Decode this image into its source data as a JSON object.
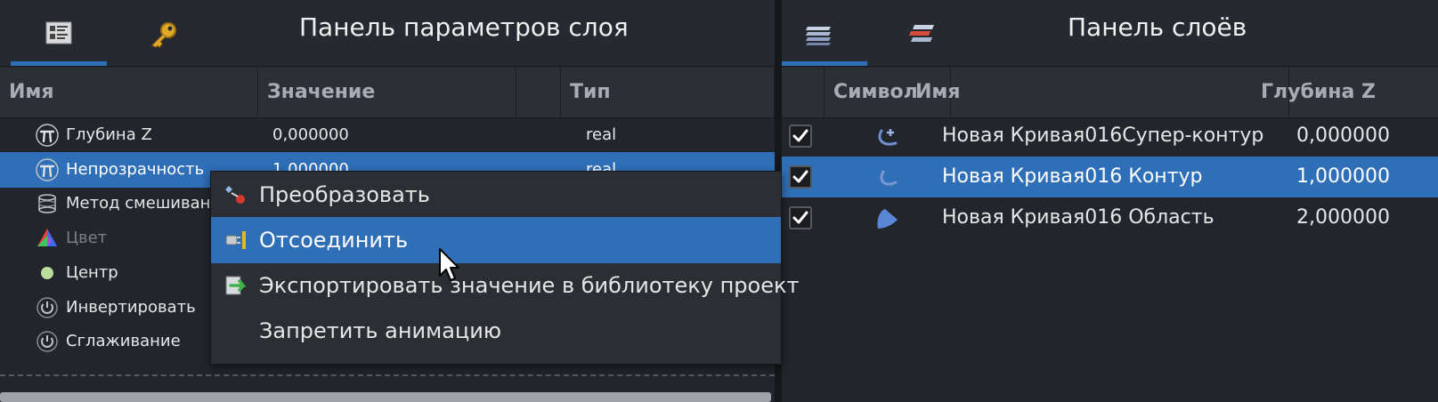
{
  "params_panel": {
    "title": "Панель параметров слоя",
    "tabs": [
      {
        "icon": "params-icon",
        "active": true
      },
      {
        "icon": "key-icon",
        "active": false
      }
    ],
    "columns": {
      "name": "Имя",
      "value": "Значение",
      "type": "Тип"
    },
    "rows": [
      {
        "icon": "pi-icon",
        "name": "Глубина Z",
        "value": "0,000000",
        "type": "real",
        "selected": false,
        "dim": false
      },
      {
        "icon": "pi-icon",
        "name": "Непрозрачность",
        "value": "1,000000",
        "type": "real",
        "selected": true,
        "dim": false
      },
      {
        "icon": "blend-icon",
        "name": "Метод смешиван",
        "value": "",
        "type": "",
        "selected": false,
        "dim": false
      },
      {
        "icon": "color-wheel-icon",
        "name": "Цвет",
        "value": "",
        "type": "",
        "selected": false,
        "dim": true
      },
      {
        "icon": "dot-icon",
        "name": "Центр",
        "value": "",
        "type": "",
        "selected": false,
        "dim": false
      },
      {
        "icon": "power-icon",
        "name": "Инвертировать",
        "value": "",
        "type": "",
        "selected": false,
        "dim": false
      },
      {
        "icon": "power-icon",
        "name": "Сглаживание",
        "value": "",
        "type": "",
        "selected": false,
        "dim": false
      }
    ]
  },
  "context_menu": {
    "items": [
      {
        "icon": "convert-icon",
        "label": "Преобразовать",
        "highlight": false
      },
      {
        "icon": "disconnect-icon",
        "label": "Отсоединить",
        "highlight": true
      },
      {
        "icon": "export-icon",
        "label": "Экспортировать значение в библиотеку проект",
        "highlight": false
      },
      {
        "icon": "",
        "label": "Запретить анимацию",
        "highlight": false
      }
    ]
  },
  "layers_panel": {
    "title": "Панель слоёв",
    "tabs": [
      {
        "icon": "layers-icon",
        "active": true
      },
      {
        "icon": "layer-sets-icon",
        "active": false
      }
    ],
    "columns": {
      "symbol": "Символ",
      "name": "Имя",
      "depth": "Глубина Z"
    },
    "rows": [
      {
        "checked": true,
        "symbol": "outline-plus-icon",
        "name": "Новая Кривая016Супер-контур",
        "depth": "0,000000",
        "selected": false
      },
      {
        "checked": true,
        "symbol": "outline-icon",
        "name": "Новая Кривая016 Контур",
        "depth": "1,000000",
        "selected": true
      },
      {
        "checked": true,
        "symbol": "region-icon",
        "name": "Новая Кривая016 Область",
        "depth": "2,000000",
        "selected": false
      }
    ]
  },
  "colors": {
    "accent": "#2e6fb7",
    "background": "#22262c",
    "header": "#2b2f36"
  }
}
